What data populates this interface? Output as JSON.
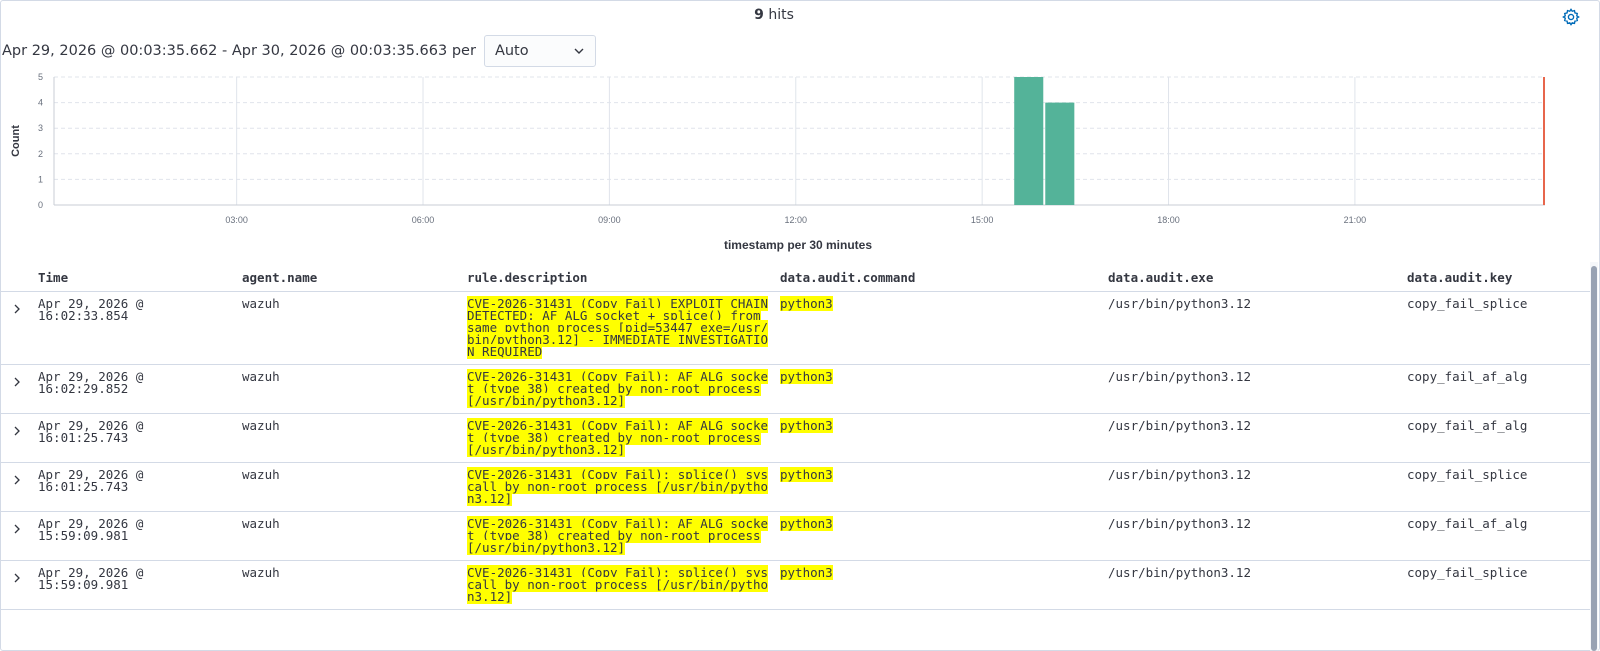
{
  "summary": {
    "hits_count": "9",
    "hits_label": " hits"
  },
  "range": {
    "text": "Apr 29, 2026 @ 00:03:35.662 - Apr 30, 2026 @ 00:03:35.663 per",
    "interval_value": "Auto"
  },
  "colors": {
    "bar": "#54b399",
    "now_marker": "#e7664c",
    "highlight": "#ffff00",
    "link_icon": "#006bb8"
  },
  "chart_data": {
    "type": "bar",
    "xlabel": "timestamp per 30 minutes",
    "ylabel": "Count",
    "ylim": [
      0,
      5
    ],
    "y_ticks": [
      "0",
      "1",
      "2",
      "3",
      "4",
      "5"
    ],
    "x_range_hours": [
      0.06,
      24.06
    ],
    "x_ticks": [
      "03:00",
      "06:00",
      "09:00",
      "12:00",
      "15:00",
      "18:00",
      "21:00"
    ],
    "bar_width_hours": 0.5,
    "bars": [
      {
        "start": "15:30",
        "value": 5
      },
      {
        "start": "16:00",
        "value": 4
      }
    ],
    "grid": true
  },
  "table": {
    "columns": [
      "Time",
      "agent.name",
      "rule.description",
      "data.audit.command",
      "data.audit.exe",
      "data.audit.key"
    ],
    "rows": [
      {
        "time": "Apr 29, 2026 @ 16:02:33.854",
        "agent": "wazuh",
        "desc": "CVE-2026-31431 (Copy Fail) EXPLOIT CHAIN DETECTED: AF_ALG socket + splice() from same python process [pid=53447 exe=/usr/bin/python3.12] - IMMEDIATE INVESTIGATION REQUIRED",
        "command": "python3",
        "exe": "/usr/bin/python3.12",
        "key": "copy_fail_splice"
      },
      {
        "time": "Apr 29, 2026 @ 16:02:29.852",
        "agent": "wazuh",
        "desc": "CVE-2026-31431 (Copy Fail): AF_ALG socket (type 38) created by non-root process [/usr/bin/python3.12]",
        "command": "python3",
        "exe": "/usr/bin/python3.12",
        "key": "copy_fail_af_alg"
      },
      {
        "time": "Apr 29, 2026 @ 16:01:25.743",
        "agent": "wazuh",
        "desc": "CVE-2026-31431 (Copy Fail): AF_ALG socket (type 38) created by non-root process [/usr/bin/python3.12]",
        "command": "python3",
        "exe": "/usr/bin/python3.12",
        "key": "copy_fail_af_alg"
      },
      {
        "time": "Apr 29, 2026 @ 16:01:25.743",
        "agent": "wazuh",
        "desc": "CVE-2026-31431 (Copy Fail): splice() syscall by non-root process [/usr/bin/python3.12]",
        "command": "python3",
        "exe": "/usr/bin/python3.12",
        "key": "copy_fail_splice"
      },
      {
        "time": "Apr 29, 2026 @ 15:59:09.981",
        "agent": "wazuh",
        "desc": "CVE-2026-31431 (Copy Fail): AF_ALG socket (type 38) created by non-root process [/usr/bin/python3.12]",
        "command": "python3",
        "exe": "/usr/bin/python3.12",
        "key": "copy_fail_af_alg"
      },
      {
        "time": "Apr 29, 2026 @ 15:59:09.981",
        "agent": "wazuh",
        "desc": "CVE-2026-31431 (Copy Fail): splice() syscall by non-root process [/usr/bin/python3.12]",
        "command": "python3",
        "exe": "/usr/bin/python3.12",
        "key": "copy_fail_splice"
      }
    ]
  }
}
